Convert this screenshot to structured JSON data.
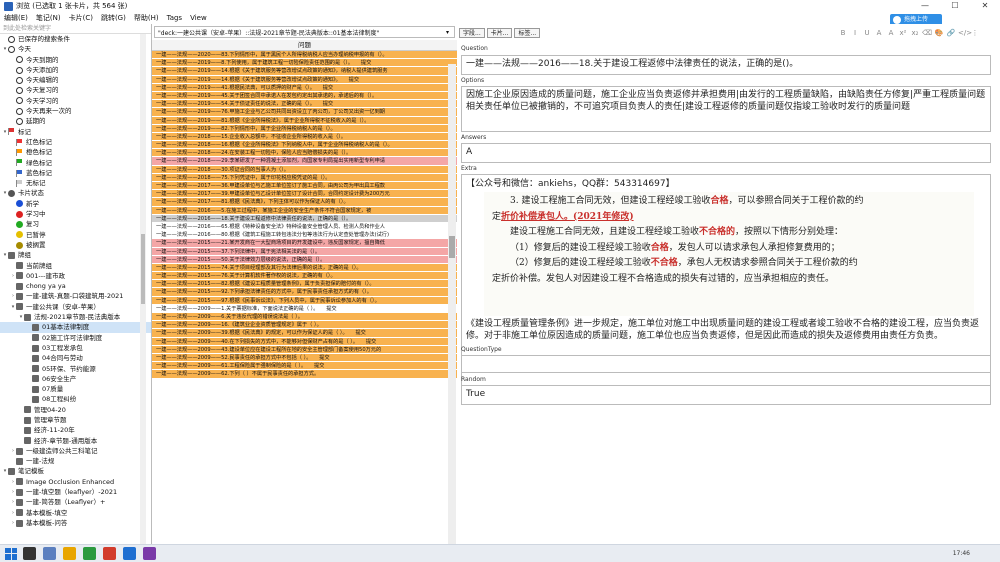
{
  "window": {
    "title": "浏览 (已选取 1 张卡片，共 564 张)",
    "controls": [
      "—",
      "☐",
      "✕"
    ]
  },
  "menu": [
    "编辑(E)",
    "笔记(N)",
    "卡片(C)",
    "跳转(G)",
    "帮助(H)",
    "Tags",
    "View"
  ],
  "cloud_button": "拖拽上传",
  "sidebar": {
    "filter_placeholder": "到此处检索关键字",
    "items": [
      {
        "label": "已保存的搜索条件",
        "icon": "search-icon",
        "level": 0,
        "toggle": ""
      },
      {
        "label": "今天",
        "icon": "clock-icon",
        "level": 0,
        "toggle": "▾"
      },
      {
        "label": "今天到期的",
        "icon": "clock-icon",
        "level": 1,
        "toggle": ""
      },
      {
        "label": "今天添加的",
        "icon": "clock-icon",
        "level": 1,
        "toggle": ""
      },
      {
        "label": "今天编辑的",
        "icon": "clock-icon",
        "level": 1,
        "toggle": ""
      },
      {
        "label": "今天复习的",
        "icon": "clock-icon",
        "level": 1,
        "toggle": ""
      },
      {
        "label": "今天学习的",
        "icon": "clock-icon",
        "level": 1,
        "toggle": ""
      },
      {
        "label": "今天再来一次的",
        "icon": "clock-icon",
        "level": 1,
        "toggle": ""
      },
      {
        "label": "延期的",
        "icon": "clock-icon",
        "level": 1,
        "toggle": ""
      },
      {
        "label": "标记",
        "icon": "flag-icon",
        "color": "#d33",
        "level": 0,
        "toggle": "▾"
      },
      {
        "label": "红色标记",
        "icon": "flag-icon",
        "color": "#e33",
        "level": 1,
        "toggle": ""
      },
      {
        "label": "橙色标记",
        "icon": "flag-icon",
        "color": "#f90",
        "level": 1,
        "toggle": ""
      },
      {
        "label": "绿色标记",
        "icon": "flag-icon",
        "color": "#2a2",
        "level": 1,
        "toggle": ""
      },
      {
        "label": "蓝色标记",
        "icon": "flag-icon",
        "color": "#36c",
        "level": 1,
        "toggle": ""
      },
      {
        "label": "无标记",
        "icon": "flag-icon",
        "color": "#ccc",
        "level": 1,
        "toggle": ""
      },
      {
        "label": "卡片状态",
        "icon": "dot-icon",
        "color": "#555",
        "level": 0,
        "toggle": "▾"
      },
      {
        "label": "新学",
        "icon": "dot-icon",
        "color": "#1a4fd6",
        "level": 1,
        "toggle": ""
      },
      {
        "label": "学习中",
        "icon": "dot-icon",
        "color": "#d22",
        "level": 1,
        "toggle": ""
      },
      {
        "label": "复习",
        "icon": "dot-icon",
        "color": "#2a2",
        "level": 1,
        "toggle": ""
      },
      {
        "label": "已暂停",
        "icon": "dot-icon",
        "color": "#e5c000",
        "level": 1,
        "toggle": ""
      },
      {
        "label": "被搁置",
        "icon": "dot-icon",
        "color": "#a68b00",
        "level": 1,
        "toggle": ""
      },
      {
        "label": "牌组",
        "icon": "deck-icon",
        "level": 0,
        "toggle": "▾"
      },
      {
        "label": "当前牌组",
        "icon": "deck-icon",
        "level": 1,
        "toggle": ""
      },
      {
        "label": "001---建市政",
        "icon": "deck-icon",
        "level": 1,
        "toggle": "›"
      },
      {
        "label": "chong ya ya",
        "icon": "deck-icon",
        "level": 1,
        "toggle": ""
      },
      {
        "label": "一建-建筑-真题-口袋建筑用-2021",
        "icon": "deck-icon",
        "level": 1,
        "toggle": "›"
      },
      {
        "label": "一建公共课（安卓-苹果）",
        "icon": "deck-icon",
        "level": 1,
        "toggle": "▾"
      },
      {
        "label": "法规-2021章节题-民法典版本",
        "icon": "deck-icon",
        "level": 2,
        "toggle": "▾"
      },
      {
        "label": "01基本法律制度",
        "icon": "deck-icon",
        "level": 3,
        "toggle": "",
        "selected": true
      },
      {
        "label": "02施工许可法律制度",
        "icon": "deck-icon",
        "level": 3,
        "toggle": ""
      },
      {
        "label": "03工程发承包",
        "icon": "deck-icon",
        "level": 3,
        "toggle": ""
      },
      {
        "label": "04合同与劳动",
        "icon": "deck-icon",
        "level": 3,
        "toggle": ""
      },
      {
        "label": "05环保、节约能源",
        "icon": "deck-icon",
        "level": 3,
        "toggle": ""
      },
      {
        "label": "06安全生产",
        "icon": "deck-icon",
        "level": 3,
        "toggle": ""
      },
      {
        "label": "07质量",
        "icon": "deck-icon",
        "level": 3,
        "toggle": ""
      },
      {
        "label": "08工程纠纷",
        "icon": "deck-icon",
        "level": 3,
        "toggle": ""
      },
      {
        "label": "管理04-20",
        "icon": "deck-icon",
        "level": 2,
        "toggle": ""
      },
      {
        "label": "管理章节题",
        "icon": "deck-icon",
        "level": 2,
        "toggle": ""
      },
      {
        "label": "经济-11-20年",
        "icon": "deck-icon",
        "level": 2,
        "toggle": ""
      },
      {
        "label": "经济-章节题-通用版本",
        "icon": "deck-icon",
        "level": 2,
        "toggle": ""
      },
      {
        "label": "一级建造师公共三科笔记",
        "icon": "deck-icon",
        "level": 1,
        "toggle": "›"
      },
      {
        "label": "一建-法规",
        "icon": "deck-icon",
        "level": 1,
        "toggle": ""
      },
      {
        "label": "笔记模板",
        "icon": "deck-icon",
        "level": 0,
        "toggle": "▾"
      },
      {
        "label": "Image Occlusion Enhanced",
        "icon": "deck-icon",
        "level": 1,
        "toggle": "›"
      },
      {
        "label": "一建-填空题（leaflyer）-2021",
        "icon": "deck-icon",
        "level": 1,
        "toggle": "›"
      },
      {
        "label": "一建-简答题（Leaflyer）+",
        "icon": "deck-icon",
        "level": 1,
        "toggle": "›"
      },
      {
        "label": "基本模板-填空",
        "icon": "deck-icon",
        "level": 1,
        "toggle": "›"
      },
      {
        "label": "基本模板-问答",
        "icon": "deck-icon",
        "level": 1,
        "toggle": "›"
      }
    ]
  },
  "search": {
    "query": "\"deck:一建公共课（安卓-苹果）::法规-2021章节题-民法典版本::01基本法律制度\""
  },
  "list": {
    "header": "问题",
    "rows": [
      {
        "text": "一建——法规——2020——83.下列情形中，属于黑民个人所得税纳税人应当办理纳税申报的有（）。",
        "c": "o"
      },
      {
        "text": "一建——法规——2019——8.下列使用，属于建筑工程一切险保险责任范围的是（）。　　提交",
        "c": "o"
      },
      {
        "text": "一建——法规——2019——14.根据《关于建筑服务等营改增试点政策的通知》，纳税人提供建筑服务",
        "c": "o"
      },
      {
        "text": "一建——法规——2019——14.根据《关于建筑服务等营改增试点政策的通知》。　　提交",
        "c": "o"
      },
      {
        "text": "一建——法规——2019——41.根据民法典，可以质押的财产是（）。　　提交",
        "c": "o"
      },
      {
        "text": "一建——法规——2019——45.关于团签合同中承诺人在发包约定出其承诺的，承诺后的有（）。",
        "c": "o"
      },
      {
        "text": "一建——法规——2019——54.关于债证责任的说法，正确的是（）。　　提交",
        "c": "o"
      },
      {
        "text": "一建——法规——2019——76.甲施工企业与乙公司共同出资设立了丙公司，丁公司又出资一亿到期",
        "c": "o"
      },
      {
        "text": "一建——法规——2019——81.根据《企业所得税法》，属于企业所得税不征税收入的是（）。",
        "c": "o"
      },
      {
        "text": "一建——法规——2019——82.下列情形中，属于企业所得税纳税人的是（）。",
        "c": "o"
      },
      {
        "text": "一建——法规——2018——15.企业收入总额中，不征收企业所得税的收入是（）。",
        "c": "o"
      },
      {
        "text": "一建——法规——2018——16.根据《企业所得税法》下列纳税人中，属于企业所得税纳税人的是（）。",
        "c": "o"
      },
      {
        "text": "一建——法规——2018——24.在安装工程一切险中，保险人应当赔偿损失的是（）。",
        "c": "o"
      },
      {
        "text": "一建——法规——2018——29.李某研发了一种混凝土添加剂，向国家专利局提出实用新型专利申请",
        "c": "p"
      },
      {
        "text": "一建——法规——2018——30.项证合同的当事人为（）。",
        "c": "o"
      },
      {
        "text": "一建——法规——2018——75.下列凭证中，属于印花税应税凭证的是（）。",
        "c": "o"
      },
      {
        "text": "一建——法规——2017——36.甲建设单位与乙施工单位签订了施工合同，由丙公司为甲出具工程款",
        "c": "o"
      },
      {
        "text": "一建——法规——2017——39.甲建设单位与乙设计单位签订了设计合同，合同约定设计费为200万元",
        "c": "o"
      },
      {
        "text": "一建——法规——2017——81.根据《民法典》，下列主体可以作为保证人的有（）。",
        "c": "o"
      },
      {
        "text": "一建——法规——2016——5.在施工过程中，某施工企业的安全生产条件不符合国家规定，被",
        "c": "o"
      },
      {
        "text": "一建——法规——2016——18.关于建设工程返修中法律责任的说法，正确的是（）。",
        "c": "s"
      },
      {
        "text": "一建——法规——2016——65.根据《特种设备安全法》特种设备安全管理人员、检测人员和作业人",
        "c": "w"
      },
      {
        "text": "一建——法规——2016——80.根据《建筑工程施工转包违法分包等违法行为认定查处管理办法(试行)",
        "c": "w"
      },
      {
        "text": "一建——法规——2015——21.某开发商在一大型商场项目的开发建设中，违反国家规定，擅自降低",
        "c": "p"
      },
      {
        "text": "一建——法规——2015——37.下列法律中，属于宪法相关法的是（）。",
        "c": "p"
      },
      {
        "text": "一建——法规——2015——50.关于法律效力层级的说法，正确的是（）。",
        "c": "p"
      },
      {
        "text": "一建——法规——2015——74.关于项目经理部及其行为法律后果的说法，正确的是（）。",
        "c": "o"
      },
      {
        "text": "一建——法规——2015——76.关于计算机软件著作权的说法，正确的有（）。",
        "c": "o"
      },
      {
        "text": "一建——法规——2015——82.根据《建设工程质量管理条例》，属于负责担保的赔付的有（）。",
        "c": "o"
      },
      {
        "text": "一建——法规——2015——92.下列承担法律责任的方式中，属于民事责任承担方式的有（）。",
        "c": "o"
      },
      {
        "text": "一建——法规——2015——97.根据《民事诉讼法》，下列人员中，属于民事诉讼参加人的有（）。",
        "c": "o"
      },
      {
        "text": "一建——法规——2009——1.关于票据标准，下面说法正确的是（ ）。　　提交",
        "c": "w"
      },
      {
        "text": "一建——法规——2009——6.关于违反代理的错误说法是（ ）。",
        "c": "o"
      },
      {
        "text": "一建——法规——2009——16.《建筑业企业资质管理规定》属于（ ）。",
        "c": "o"
      },
      {
        "text": "一建——法规——2009——39.根据《民法典》的规定，可以作为保证人的是（ ）。　　提交",
        "c": "o"
      },
      {
        "text": "一建——法规——2009——40.在下列损失的方式中，不能够对但保财产占有的是（ ）。　　提交",
        "c": "o"
      },
      {
        "text": "一建——法规——2009——43.建设单位应在建设工程所在地的安全主管理部门备案使用50万元的",
        "c": "o"
      },
      {
        "text": "一建——法规——2009——52.民事责任的承担方式中不包括（ ）。　　提交",
        "c": "o"
      },
      {
        "text": "一建——法规——2009——61.工程保险属于强制保险的是（ ）。　　提交",
        "c": "o"
      },
      {
        "text": "一建——法规——2009——62.下列（ ）不属于民事责任的承担方式。",
        "c": "o"
      }
    ]
  },
  "editor": {
    "buttons": [
      "字段...",
      "卡片...",
      "标签..."
    ],
    "format_buttons": [
      "B",
      "I",
      "U",
      "A",
      "A",
      "x²",
      "x₂",
      "⌫",
      "🎨",
      "🔗",
      "</>",
      "⋮"
    ],
    "question_label": "Question",
    "question": "一建——法规——2016——18.关于建设工程返修中法律责任的说法，正确的是()。",
    "options_label": "Options",
    "options": "因施工企业原因造成的质量问题，施工企业应当负责返修并承担费用|由发行的工程质量缺陷，由缺陷责任方修复|严重工程质量问题相关责任单位已被撤销的，不可追究项目负责人的责任|建设工程返修的质量问题仅指竣工验收时发行的质量问题",
    "answers_label": "Answers",
    "answers": "A",
    "extra_label": "Extra",
    "contact": "【公众号和微信：ankiehs，QQ群：543314697】",
    "scan_lines": [
      {
        "a": "3. 建设工程施工合同无效，但建设工程经竣工验收",
        "b": "合格",
        "c": "，可以参照合同关于工程价款的约"
      },
      {
        "a": "定",
        "b": "折价补偿承包人。(2021年修改)",
        "c": ""
      },
      {
        "a": "建设工程施工合同无效，且建设工程经竣工验收",
        "b": "不合格的",
        "c": "，按照以下情形分别处理："
      },
      {
        "a": "（1）修复后的建设工程经竣工验收",
        "b": "合格",
        "c": "，发包人可以请求承包人承担修复费用的；"
      },
      {
        "a": "（2）修复后的建设工程经竣工验收",
        "b": "不合格",
        "c": "，承包人无权请求参照合同关于工程价款的约"
      },
      {
        "a": "定折价补偿。发包人对因建设工程不合格造成的损失有过错的，应当承担相应的责任。",
        "b": "",
        "c": ""
      }
    ],
    "extra_text": "《建设工程质量管理条例》进一步规定，施工单位对施工中出现质量问题的建设工程或者竣工验收不合格的建设工程，应当负责返修。对于非施工单位原因造成的质量问题，施工单位也应当负责返修，但是因此而造成的损失及返修费用由责任方负责。",
    "qtype_label": "QuestionType",
    "qtype": "",
    "random_label": "Random",
    "random": "True"
  },
  "taskbar": {
    "time": "17:46"
  }
}
